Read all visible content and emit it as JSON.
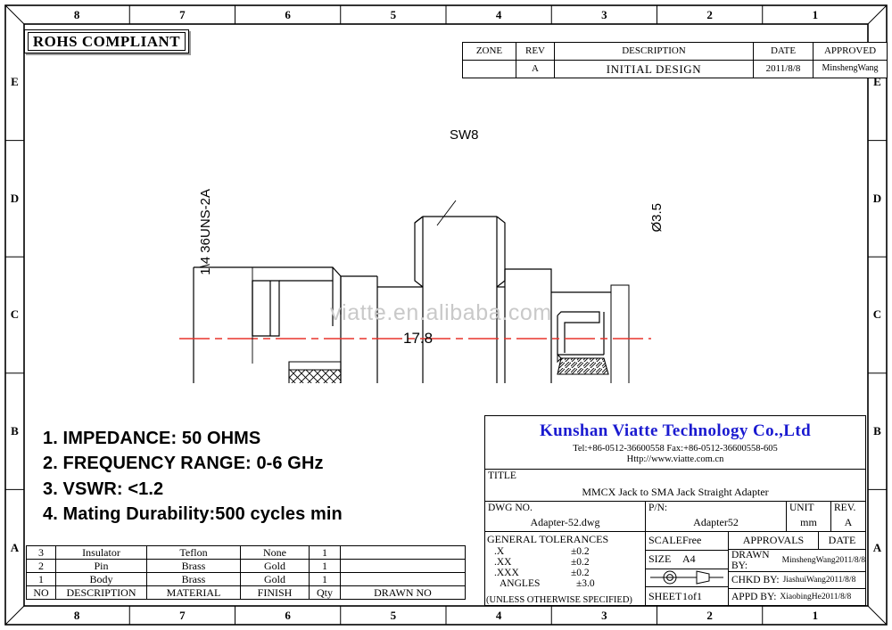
{
  "sheet": {
    "zones_top": [
      "8",
      "7",
      "6",
      "5",
      "4",
      "3",
      "2",
      "1"
    ],
    "zones_bottom": [
      "8",
      "7",
      "6",
      "5",
      "4",
      "3",
      "2",
      "1"
    ],
    "zones_left": [
      "E",
      "D",
      "C",
      "B",
      "A"
    ],
    "zones_right": [
      "E",
      "D",
      "C",
      "B",
      "A"
    ]
  },
  "rohs": {
    "label": "ROHS COMPLIANT"
  },
  "revision_table": {
    "headers": [
      "ZONE",
      "REV",
      "DESCRIPTION",
      "DATE",
      "APPROVED"
    ],
    "rows": [
      {
        "zone": "",
        "rev": "A",
        "description": "INITIAL DESIGN",
        "date": "2011/8/8",
        "approved": "MinshengWang"
      }
    ]
  },
  "drawing": {
    "thread_label": "1\\4  36UNS-2A",
    "hex_label": "SW8",
    "diameter_label": "Ø3.5",
    "length_label": "17.8",
    "centerline_color": "#e8342c",
    "watermark": "viatte.en.alibaba.com"
  },
  "specs": [
    "1. IMPEDANCE: 50 OHMS",
    "2. FREQUENCY RANGE: 0-6 GHz",
    "3. VSWR: <1.2",
    "4. Mating Durability:500 cycles min"
  ],
  "bom": {
    "headers": [
      "NO",
      "DESCRIPTION",
      "MATERIAL",
      "FINISH",
      "Qty",
      "DRAWN NO"
    ],
    "rows": [
      {
        "no": "3",
        "description": "Insulator",
        "material": "Teflon",
        "finish": "None",
        "qty": "1",
        "drawn_no": ""
      },
      {
        "no": "2",
        "description": "Pin",
        "material": "Brass",
        "finish": "Gold",
        "qty": "1",
        "drawn_no": ""
      },
      {
        "no": "1",
        "description": "Body",
        "material": "Brass",
        "finish": "Gold",
        "qty": "1",
        "drawn_no": ""
      }
    ]
  },
  "title_block": {
    "company_name": "Kunshan Viatte Technology Co.,Ltd",
    "company_tel_fax": "Tel:+86-0512-36600558    Fax:+86-0512-36600558-605",
    "company_url": "Http://www.viatte.com.cn",
    "company_color": "#1a1ad0",
    "title_label": "TITLE",
    "title_value": "MMCX Jack to SMA Jack Straight Adapter",
    "dwg_no_label": "DWG NO.",
    "dwg_no_value": "Adapter-52.dwg",
    "pn_label": "P/N:",
    "pn_value": "Adapter52",
    "unit_label": "UNIT",
    "unit_value": "mm",
    "rev_label": "REV.",
    "rev_value": "A",
    "tolerances": {
      "heading": "GENERAL  TOLERANCES",
      "rows": [
        {
          "key": ".X",
          "value": "±0.2"
        },
        {
          "key": ".XX",
          "value": "±0.2"
        },
        {
          "key": ".XXX",
          "value": "±0.2"
        },
        {
          "key": "ANGLES",
          "value": "±3.0"
        }
      ],
      "note": "(UNLESS OTHERWISE SPECIFIED)"
    },
    "scale_label": "SCALE",
    "scale_value": "Free",
    "size_label": "SIZE",
    "size_value": "A4",
    "projection_symbol": "first-angle-projection-symbol",
    "sheet_label": "SHEET",
    "sheet_value": "1of1",
    "approvals_label": "APPROVALS",
    "date_label": "DATE",
    "approvals": [
      {
        "role": "DRAWN BY:",
        "name": "MinshengWang2011/8/8"
      },
      {
        "role": "CHKD BY:",
        "name": "JiashuiWang2011/8/8"
      },
      {
        "role": "APPD BY:",
        "name": "XiaobingHe2011/8/8"
      }
    ]
  }
}
